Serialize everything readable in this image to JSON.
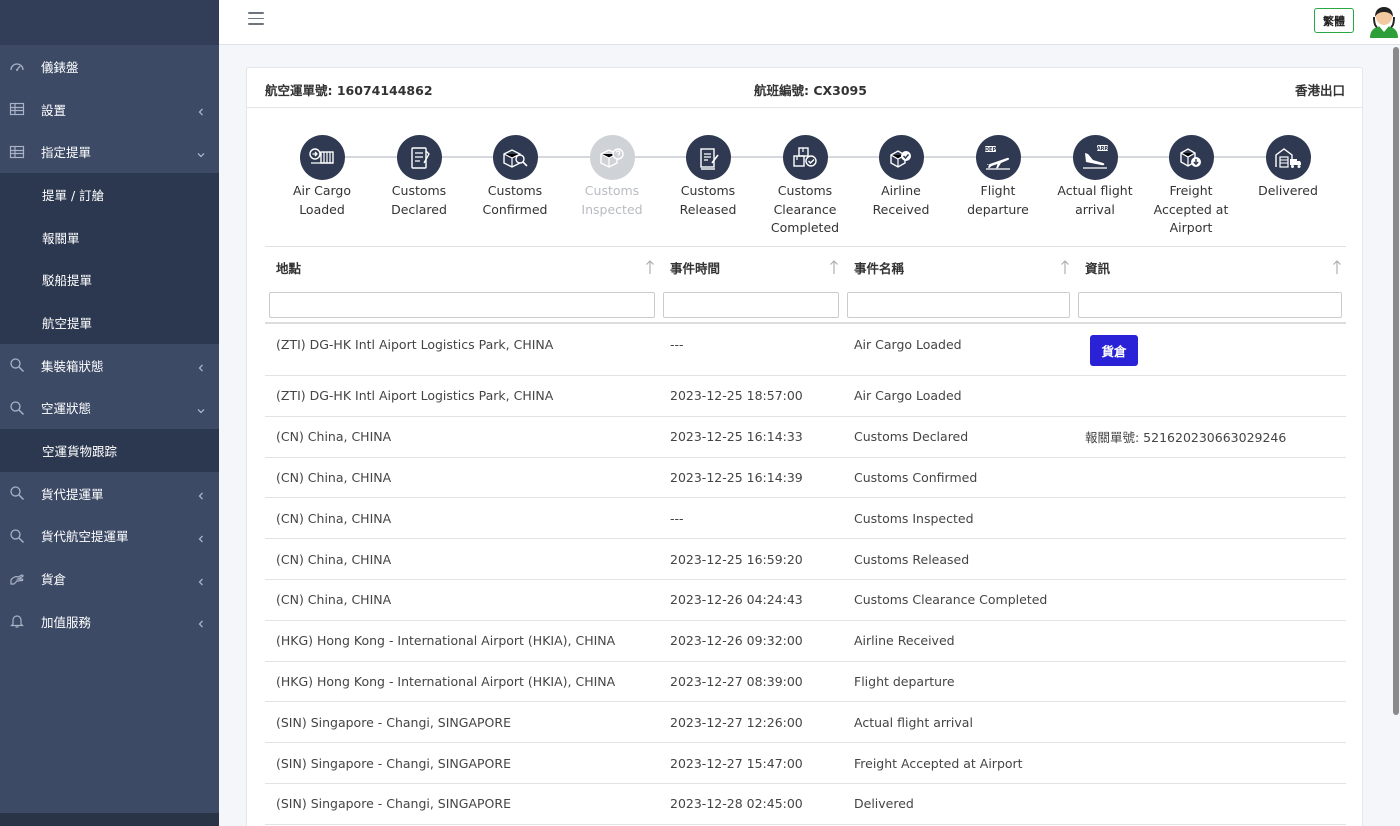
{
  "sidebar": {
    "items": [
      {
        "label": "儀錶盤",
        "icon": "gauge-icon"
      },
      {
        "label": "設置",
        "icon": "grid-icon"
      },
      {
        "label": "指定提單",
        "icon": "grid-icon"
      },
      {
        "label": "集裝箱狀態",
        "icon": "search-icon"
      },
      {
        "label": "空運狀態",
        "icon": "search-icon"
      },
      {
        "label": "貨代提運單",
        "icon": "search-icon"
      },
      {
        "label": "貨代航空提運單",
        "icon": "search-icon"
      },
      {
        "label": "貨倉",
        "icon": "hand-icon"
      },
      {
        "label": "加值服務",
        "icon": "bell-icon"
      }
    ],
    "sub_designated": [
      "提單 / 訂艙",
      "報關單",
      "駁船提單",
      "航空提單"
    ],
    "sub_air": [
      "空運貨物跟踪"
    ]
  },
  "topbar": {
    "lang_label": "繁體"
  },
  "header": {
    "awb": "航空運單號: 16074144862",
    "flight": "航班編號: CX3095",
    "export": "香港出口"
  },
  "steps": [
    {
      "label": "Air Cargo Loaded",
      "icon": "cargo-loaded-icon",
      "active": true
    },
    {
      "label": "Customs Declared",
      "icon": "customs-declared-icon",
      "active": true
    },
    {
      "label": "Customs Confirmed",
      "icon": "customs-confirmed-icon",
      "active": true
    },
    {
      "label": "Customs Inspected",
      "icon": "customs-inspected-icon",
      "active": false
    },
    {
      "label": "Customs Released",
      "icon": "customs-released-icon",
      "active": true
    },
    {
      "label": "Customs Clearance Completed",
      "icon": "clearance-completed-icon",
      "active": true
    },
    {
      "label": "Airline Received",
      "icon": "airline-received-icon",
      "active": true
    },
    {
      "label": "Flight departure",
      "icon": "flight-departure-icon",
      "active": true
    },
    {
      "label": "Actual flight arrival",
      "icon": "flight-arrival-icon",
      "active": true
    },
    {
      "label": "Freight Accepted at Airport",
      "icon": "freight-accepted-icon",
      "active": true
    },
    {
      "label": "Delivered",
      "icon": "delivered-icon",
      "active": true
    }
  ],
  "table": {
    "columns": [
      "地點",
      "事件時間",
      "事件名稱",
      "資訊"
    ],
    "warehouse_button": "貨倉",
    "rows": [
      {
        "location": "(ZTI) DG-HK Intl Aiport Logistics Park, CHINA",
        "time": "---",
        "event": "Air Cargo Loaded",
        "info": ""
      },
      {
        "location": "(ZTI) DG-HK Intl Aiport Logistics Park, CHINA",
        "time": "2023-12-25 18:57:00",
        "event": "Air Cargo Loaded",
        "info": ""
      },
      {
        "location": "(CN) China, CHINA",
        "time": "2023-12-25 16:14:33",
        "event": "Customs Declared",
        "info": "報關單號: 521620230663029246"
      },
      {
        "location": "(CN) China, CHINA",
        "time": "2023-12-25 16:14:39",
        "event": "Customs Confirmed",
        "info": ""
      },
      {
        "location": "(CN) China, CHINA",
        "time": "---",
        "event": "Customs Inspected",
        "info": ""
      },
      {
        "location": "(CN) China, CHINA",
        "time": "2023-12-25 16:59:20",
        "event": "Customs Released",
        "info": ""
      },
      {
        "location": "(CN) China, CHINA",
        "time": "2023-12-26 04:24:43",
        "event": "Customs Clearance Completed",
        "info": ""
      },
      {
        "location": "(HKG) Hong Kong - International Airport (HKIA), CHINA",
        "time": "2023-12-26 09:32:00",
        "event": "Airline Received",
        "info": ""
      },
      {
        "location": "(HKG) Hong Kong - International Airport (HKIA), CHINA",
        "time": "2023-12-27 08:39:00",
        "event": "Flight departure",
        "info": ""
      },
      {
        "location": "(SIN) Singapore - Changi, SINGAPORE",
        "time": "2023-12-27 12:26:00",
        "event": "Actual flight arrival",
        "info": ""
      },
      {
        "location": "(SIN) Singapore - Changi, SINGAPORE",
        "time": "2023-12-27 15:47:00",
        "event": "Freight Accepted at Airport",
        "info": ""
      },
      {
        "location": "(SIN) Singapore - Changi, SINGAPORE",
        "time": "2023-12-28 02:45:00",
        "event": "Delivered",
        "info": ""
      }
    ]
  },
  "colors": {
    "sidebar": "#3c4a66",
    "sidebar_sub": "#2c3850",
    "step_active": "#2f3a52",
    "step_inactive": "#cfd2d6",
    "button": "#2a22d6",
    "lang_border": "#28a745"
  }
}
